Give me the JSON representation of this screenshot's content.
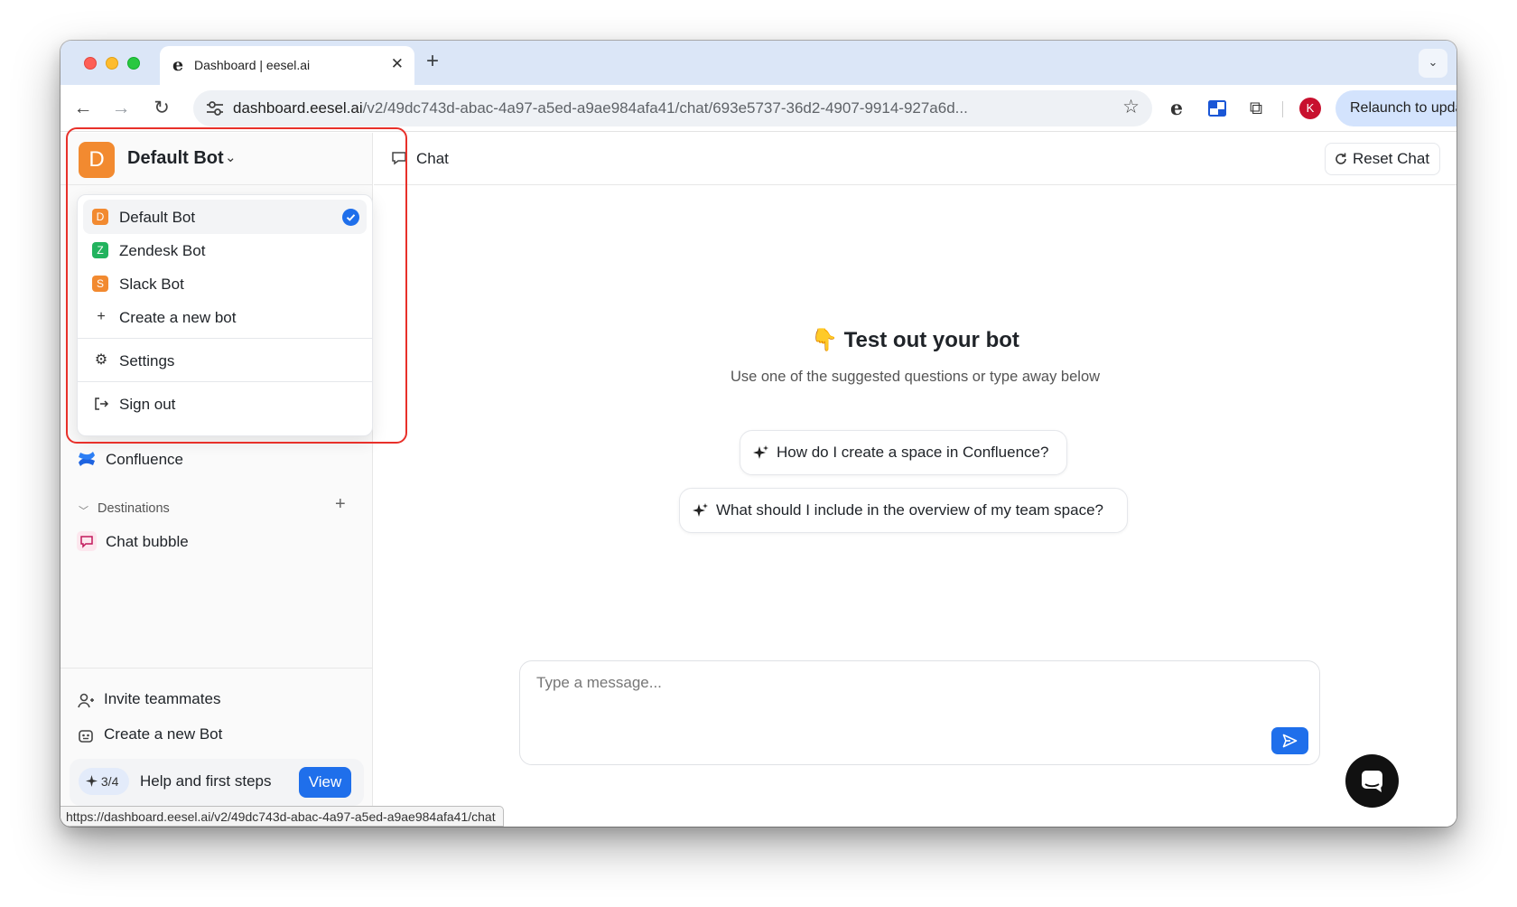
{
  "browser": {
    "tab_title": "Dashboard | eesel.ai",
    "tab_favicon": "e",
    "url_host": "dashboard.eesel.ai",
    "url_path": "/v2/49dc743d-abac-4a97-a5ed-a9ae984afa41/chat/693e5737-36d2-4907-9914-927a6d...",
    "profile_initial": "K",
    "relaunch_label": "Relaunch to update",
    "status_url": "https://dashboard.eesel.ai/v2/49dc743d-abac-4a97-a5ed-a9ae984afa41/chat"
  },
  "sidebar": {
    "bot_initial": "D",
    "bot_name": "Default Bot",
    "source_item": "Confluence",
    "destinations_label": "Destinations",
    "destination_item": "Chat bubble",
    "invite_label": "Invite teammates",
    "create_bot_label": "Create a new Bot",
    "help": {
      "progress": "3/4",
      "label": "Help and first steps",
      "view_label": "View"
    }
  },
  "bot_menu": {
    "bots": [
      {
        "initial": "D",
        "name": "Default Bot",
        "color": "#f28a30",
        "selected": true
      },
      {
        "initial": "Z",
        "name": "Zendesk Bot",
        "color": "#22b35e",
        "selected": false
      },
      {
        "initial": "S",
        "name": "Slack Bot",
        "color": "#f28a30",
        "selected": false
      }
    ],
    "create_label": "Create a new bot",
    "settings_label": "Settings",
    "signout_label": "Sign out"
  },
  "main": {
    "header_title": "Chat",
    "reset_label": "Reset Chat",
    "hero_emoji": "👇",
    "hero_title": "Test out your bot",
    "hero_subtitle": "Use one of the suggested questions or type away below",
    "suggestions": [
      "How do I create a space in Confluence?",
      "What should I include in the overview of my team space?"
    ],
    "composer_placeholder": "Type a message..."
  },
  "colors": {
    "accent": "#1f6feb",
    "highlight_border": "#e8302a",
    "tabstrip": "#dbe6f7"
  }
}
